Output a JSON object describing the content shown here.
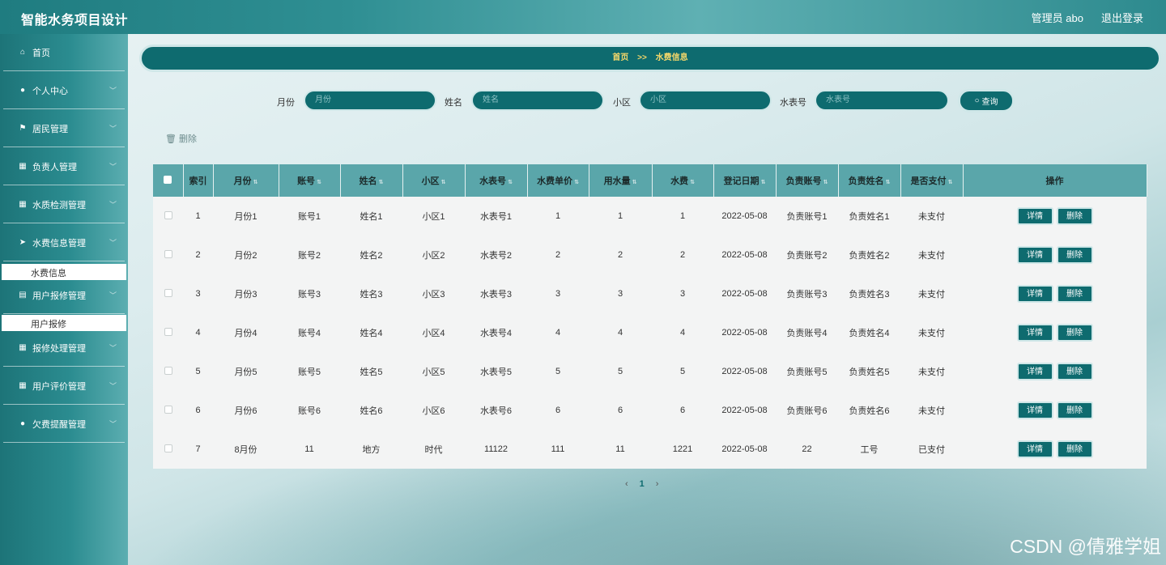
{
  "app": {
    "title": "智能水务项目设计"
  },
  "top_right": {
    "user": "管理员 abo",
    "logout": "退出登录"
  },
  "sidebar": {
    "items": [
      {
        "label": "首页",
        "icon": "home-icon"
      },
      {
        "label": "个人中心",
        "icon": "user-icon"
      },
      {
        "label": "居民管理",
        "icon": "flag-icon"
      },
      {
        "label": "负责人管理",
        "icon": "grid-icon"
      },
      {
        "label": "水质检测管理",
        "icon": "grid-icon"
      },
      {
        "label": "水费信息管理",
        "icon": "send-icon"
      },
      {
        "label": "用户报修管理",
        "icon": "clipboard-icon"
      },
      {
        "label": "报修处理管理",
        "icon": "grid-icon"
      },
      {
        "label": "用户评价管理",
        "icon": "grid-icon"
      },
      {
        "label": "欠费提醒管理",
        "icon": "bulb-icon"
      }
    ],
    "sub_items": [
      "水费信息",
      "用户报修"
    ]
  },
  "breadcrumb": {
    "home": "首页",
    "sep": ">>",
    "current": "水费信息"
  },
  "search": {
    "month_label": "月份",
    "month_placeholder": "月份",
    "name_label": "姓名",
    "name_placeholder": "姓名",
    "district_label": "小区",
    "district_placeholder": "小区",
    "meter_label": "水表号",
    "meter_placeholder": "水表号",
    "button": "查询"
  },
  "toolbar": {
    "delete_label": "删除"
  },
  "table": {
    "columns": [
      "索引",
      "月份",
      "账号",
      "姓名",
      "小区",
      "水表号",
      "水费单价",
      "用水量",
      "水费",
      "登记日期",
      "负责账号",
      "负责姓名",
      "是否支付",
      "操作"
    ],
    "rows": [
      [
        "1",
        "月份1",
        "账号1",
        "姓名1",
        "小区1",
        "水表号1",
        "1",
        "1",
        "1",
        "2022-05-08",
        "负责账号1",
        "负责姓名1",
        "未支付"
      ],
      [
        "2",
        "月份2",
        "账号2",
        "姓名2",
        "小区2",
        "水表号2",
        "2",
        "2",
        "2",
        "2022-05-08",
        "负责账号2",
        "负责姓名2",
        "未支付"
      ],
      [
        "3",
        "月份3",
        "账号3",
        "姓名3",
        "小区3",
        "水表号3",
        "3",
        "3",
        "3",
        "2022-05-08",
        "负责账号3",
        "负责姓名3",
        "未支付"
      ],
      [
        "4",
        "月份4",
        "账号4",
        "姓名4",
        "小区4",
        "水表号4",
        "4",
        "4",
        "4",
        "2022-05-08",
        "负责账号4",
        "负责姓名4",
        "未支付"
      ],
      [
        "5",
        "月份5",
        "账号5",
        "姓名5",
        "小区5",
        "水表号5",
        "5",
        "5",
        "5",
        "2022-05-08",
        "负责账号5",
        "负责姓名5",
        "未支付"
      ],
      [
        "6",
        "月份6",
        "账号6",
        "姓名6",
        "小区6",
        "水表号6",
        "6",
        "6",
        "6",
        "2022-05-08",
        "负责账号6",
        "负责姓名6",
        "未支付"
      ],
      [
        "7",
        "8月份",
        "11",
        "地方",
        "时代",
        "11122",
        "111",
        "11",
        "1221",
        "2022-05-08",
        "22",
        "工号",
        "已支付"
      ]
    ],
    "detail_label": "详情",
    "delete_label": "删除"
  },
  "pagination": {
    "prev": "‹",
    "current": "1",
    "next": "›"
  },
  "watermark": "CSDN @倩雅学姐"
}
